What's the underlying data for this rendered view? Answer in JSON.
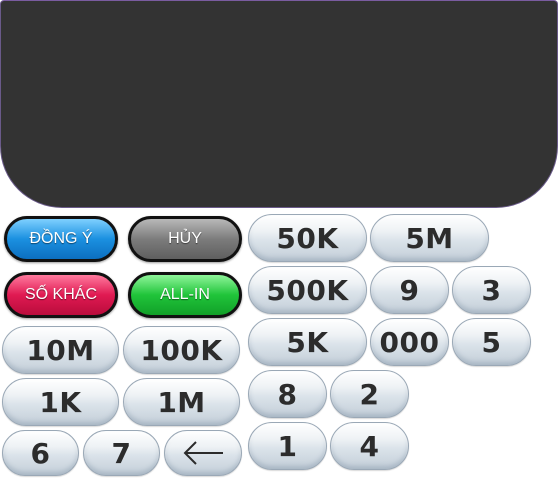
{
  "actions": {
    "confirm": "ĐỒNG Ý",
    "cancel": "HỦY",
    "other_amount": "SỐ KHÁC",
    "all_in": "ALL-IN"
  },
  "keys": {
    "k50k": "50K",
    "k5m": "5M",
    "k500k": "500K",
    "k9": "9",
    "k3": "3",
    "k10m": "10M",
    "k100k": "100K",
    "k5k": "5K",
    "k000": "000",
    "k5": "5",
    "k1k": "1K",
    "k1m": "1M",
    "k8": "8",
    "k2": "2",
    "k6": "6",
    "k7": "7",
    "k1": "1",
    "k4": "4"
  },
  "icons": {
    "backspace": "back-arrow-icon"
  },
  "colors": {
    "display_bg": "#333333",
    "confirm": "#1b90e0",
    "cancel": "#7c7c7c",
    "other_amount": "#e01a52",
    "all_in": "#20c43a"
  }
}
